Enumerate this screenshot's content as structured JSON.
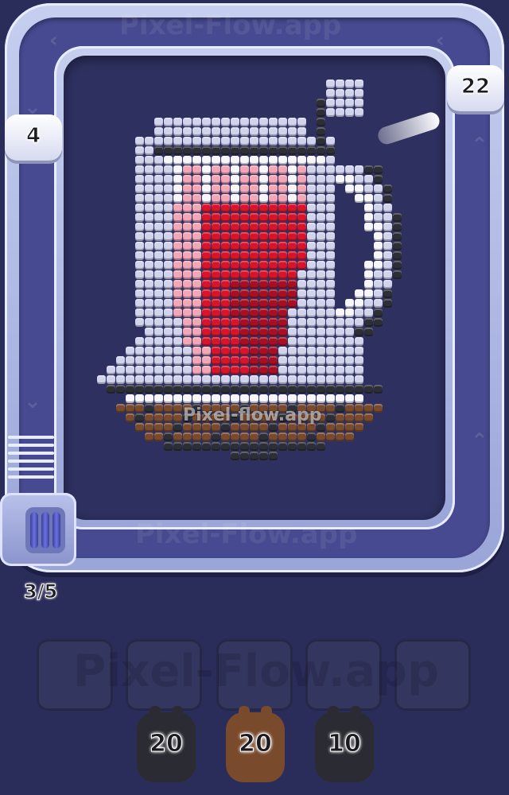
{
  "watermark": {
    "top": "Pixel-Flow.app",
    "center": "Pixel-flow.app",
    "bottom": "Pixel-Flow.app",
    "slots": "Pixel-Flow.app"
  },
  "shooters": [
    {
      "count": "22",
      "color": "#ffffff"
    },
    {
      "count": "4",
      "color": "#ffffff"
    }
  ],
  "progress": {
    "label": "3/5",
    "current": 3,
    "total": 5
  },
  "queue_slots": 5,
  "ammo": [
    {
      "count": "20",
      "color": "#2b2c33"
    },
    {
      "count": "20",
      "color": "#7a4a2c"
    },
    {
      "count": "10",
      "color": "#2b2c33"
    }
  ],
  "palette": {
    "light": "#d2d4ee",
    "dark": "#2d2f36",
    "white": "#f6f6fb",
    "pink": "#f2a6b6",
    "red": "#d8142a",
    "crimson": "#a80f22",
    "brown": "#7a4a2c"
  }
}
